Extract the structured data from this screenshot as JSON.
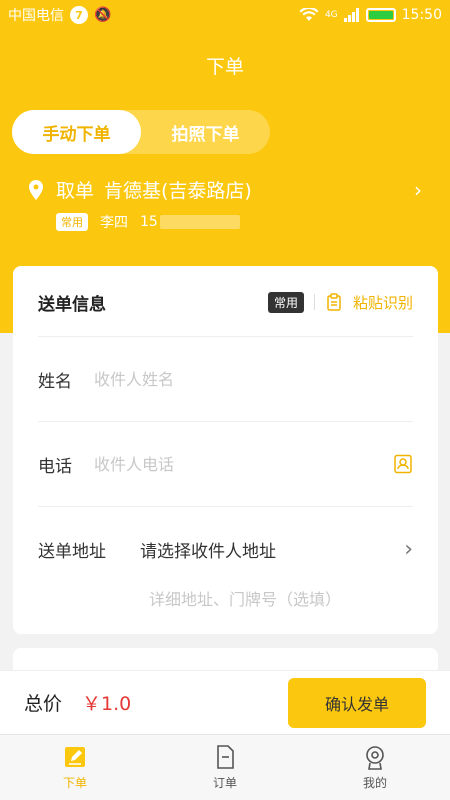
{
  "status_bar": {
    "carrier": "中国电信",
    "notification_count": "7",
    "network": "4G",
    "time": "15:50"
  },
  "nav": {
    "title": "下单"
  },
  "tabs": [
    {
      "label": "手动下单",
      "active": true
    },
    {
      "label": "拍照下单",
      "active": false
    }
  ],
  "pickup": {
    "label": "取单",
    "store": "肯德基(吉泰路店)",
    "tag": "常用",
    "contact_name": "李四",
    "phone_prefix": "15"
  },
  "delivery": {
    "title": "送单信息",
    "tag": "常用",
    "paste_label": "粘贴识别",
    "name_label": "姓名",
    "name_placeholder": "收件人姓名",
    "phone_label": "电话",
    "phone_placeholder": "收件人电话",
    "address_label": "送单地址",
    "address_value": "请选择收件人地址",
    "detail_placeholder": "详细地址、门牌号（选填）"
  },
  "price": {
    "label": "总价",
    "value": "￥1.0",
    "confirm_label": "确认发单"
  },
  "tabbar": [
    {
      "label": "下单",
      "active": true
    },
    {
      "label": "订单",
      "active": false
    },
    {
      "label": "我的",
      "active": false
    }
  ],
  "colors": {
    "brand": "#fcc80f",
    "accent_text": "#f0b400",
    "price": "#e53935"
  }
}
